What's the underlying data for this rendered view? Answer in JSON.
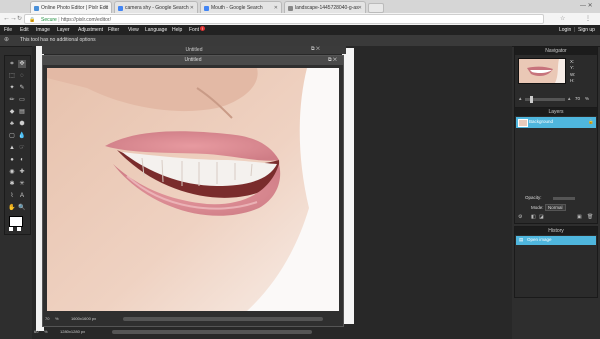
{
  "browser": {
    "tabs": [
      {
        "title": "Online Photo Editor | Pixlr Edit",
        "favicon_color": "#4a90d9"
      },
      {
        "title": "camera shy - Google Search",
        "favicon_color": "#4285f4"
      },
      {
        "title": "Mouth - Google Search",
        "favicon_color": "#4285f4"
      },
      {
        "title": "landscape-1445728040-g-as",
        "favicon_color": "#888888"
      }
    ],
    "secure_label": "Secure",
    "url": "https://pixlr.com/editor/"
  },
  "menu": {
    "items": [
      "File",
      "Edit",
      "Image",
      "Layer",
      "Adjustment",
      "Filter",
      "View",
      "Language",
      "Help",
      "Font"
    ],
    "font_badge": "!",
    "login": "Login",
    "signup": "Sign up"
  },
  "options_bar": {
    "message": "This tool has no additional options"
  },
  "canvas": {
    "back_title": "Untitled",
    "front_title": "Untitled",
    "zoom": "70",
    "dimensions": "1600x1600 px",
    "zoom2": "60",
    "dimensions2": "1280x1280 px"
  },
  "navigator": {
    "title": "Navigator",
    "x_label": "X:",
    "y_label": "Y:",
    "w_label": "W:",
    "h_label": "H:",
    "zoom_value": "70",
    "zoom_unit": "%"
  },
  "layers": {
    "title": "Layers",
    "items": [
      {
        "name": "Background"
      }
    ],
    "opacity_label": "Opacity:",
    "mode_label": "Mode:",
    "mode_value": "Normal"
  },
  "history": {
    "title": "History",
    "items": [
      {
        "name": "Open image"
      }
    ]
  },
  "colors": {
    "accent": "#4fb6dd",
    "menubar": "#222222"
  }
}
